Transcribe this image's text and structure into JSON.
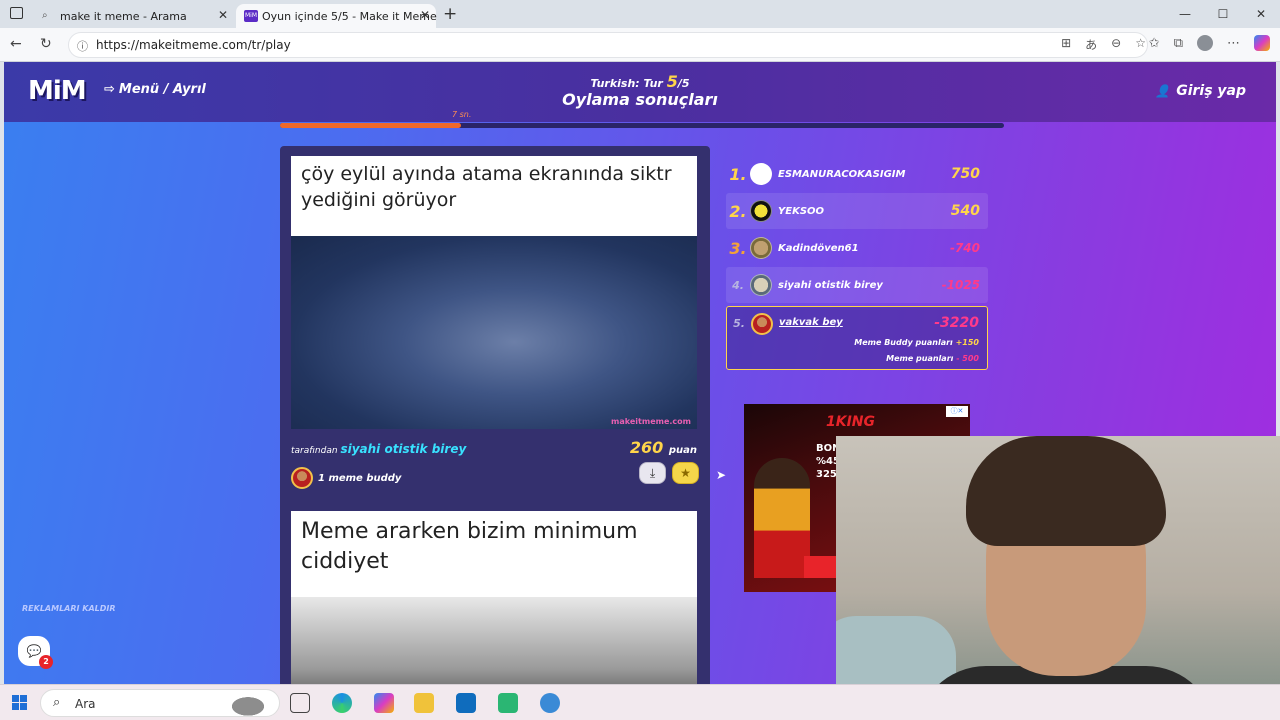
{
  "browser": {
    "tabs": [
      {
        "title": "make it meme - Arama",
        "active": false
      },
      {
        "title": "Oyun içinde 5/5 - Make it Meme",
        "active": true
      }
    ],
    "url": "https://makeitmeme.com/tr/play"
  },
  "header": {
    "logo": "MiM",
    "menu_label": "Menü / Ayrıl",
    "round_prefix": "Turkish: Tur ",
    "round_current": "5",
    "round_total": "/5",
    "phase": "Oylama sonuçları",
    "login_label": "Giriş yap"
  },
  "timer": {
    "label": "7 sn.",
    "progress": 0.25
  },
  "memes": [
    {
      "caption": "çöy eylül ayında atama ekranında siktr yediğini görüyor",
      "watermark": "makeitmeme.com",
      "by_prefix": "tarafından ",
      "author": "siyahi otistik birey",
      "points": "260",
      "points_unit": "puan",
      "buddy_text": "1 meme buddy"
    },
    {
      "caption": "Meme ararken bizim minimum ciddiyet"
    }
  ],
  "leaderboard": [
    {
      "rank": "1.",
      "name": "ESMANURACOKASIGIM",
      "score": "750"
    },
    {
      "rank": "2.",
      "name": "YEKSOO",
      "score": "540"
    },
    {
      "rank": "3.",
      "name": "Kadindöven61",
      "score": "-740"
    },
    {
      "rank": "4.",
      "name": "siyahi otistik birey",
      "score": "-1025"
    },
    {
      "rank": "5.",
      "name": "vakvak bey",
      "score": "-3220",
      "breakdown": [
        {
          "label": "Meme Buddy puanları",
          "value": "+150"
        },
        {
          "label": "Meme puanları",
          "value": "- 500"
        }
      ]
    }
  ],
  "ad": {
    "brand": "1KING",
    "bonus": "BONUSL",
    "line2": "%45",
    "line3": "325"
  },
  "sidebar": {
    "remove_ads": "REKLAMLARI KALDIR",
    "chat_badge": "2"
  },
  "taskbar": {
    "search_placeholder": "Ara"
  }
}
